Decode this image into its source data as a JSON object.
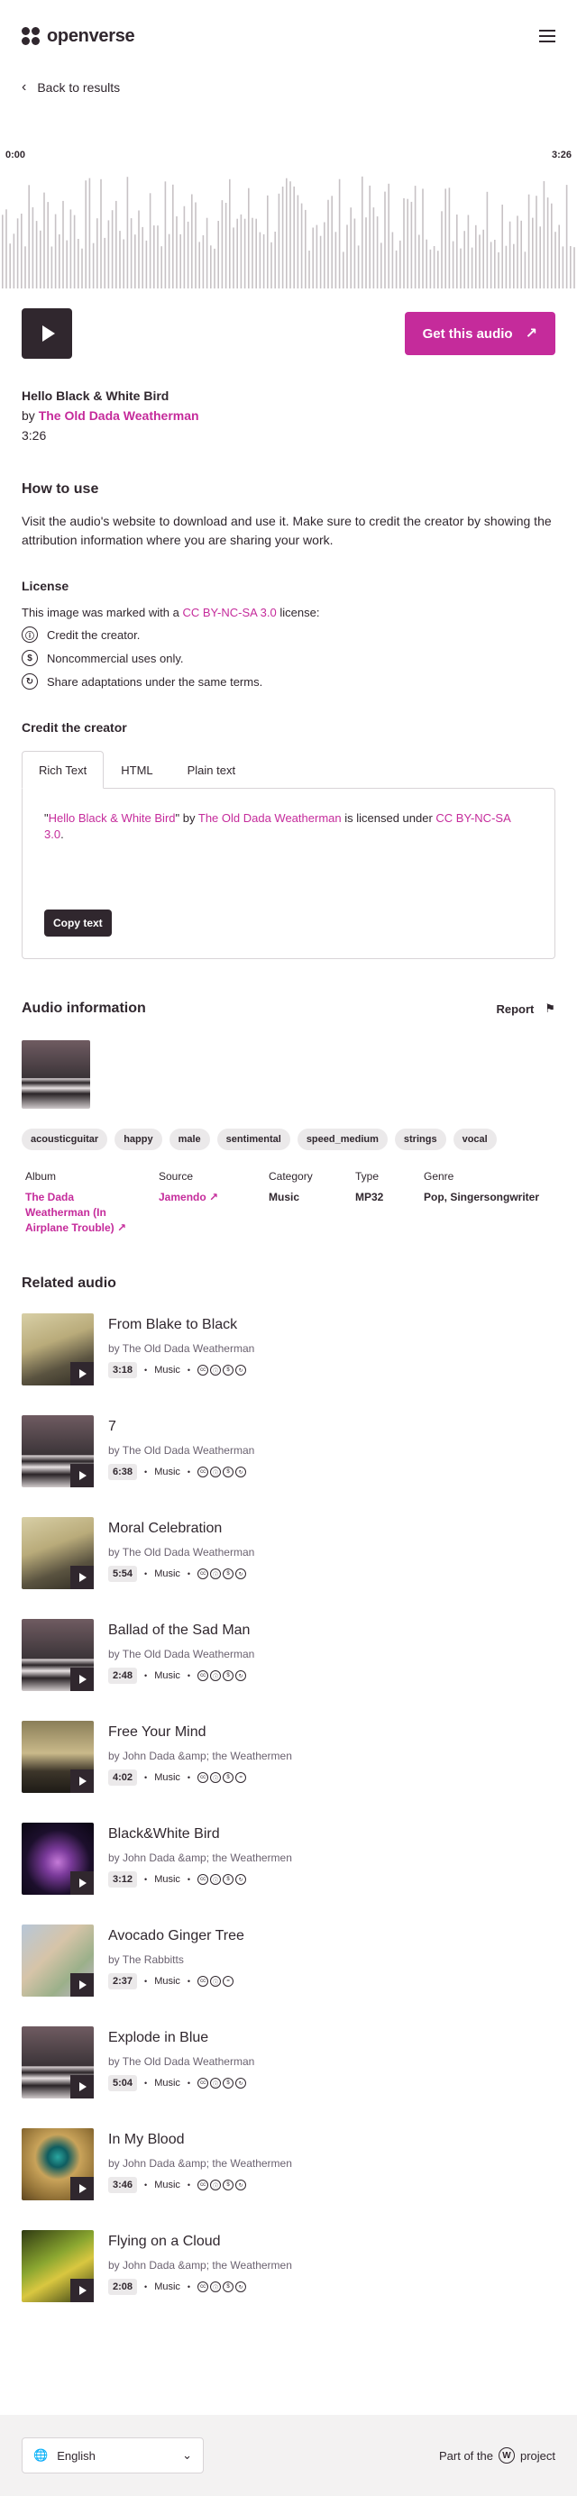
{
  "header": {
    "brand": "openverse"
  },
  "nav": {
    "back_label": "Back to results"
  },
  "player": {
    "time_start": "0:00",
    "time_end": "3:26",
    "get_label": "Get this audio"
  },
  "track": {
    "title": "Hello Black & White Bird",
    "by_prefix": "by",
    "artist": "The Old Dada Weatherman",
    "duration": "3:26"
  },
  "how_to": {
    "heading": "How to use",
    "text": "Visit the audio's website to download and use it. Make sure to credit the creator by showing the attribution information where you are sharing your work."
  },
  "license": {
    "heading": "License",
    "intro_prefix": "This image was marked with a",
    "license_name": "CC BY-NC-SA 3.0",
    "intro_suffix": "license:",
    "items": [
      {
        "icon": "by-icon",
        "text": "Credit the creator."
      },
      {
        "icon": "nc-icon",
        "text": "Noncommercial uses only."
      },
      {
        "icon": "sa-icon",
        "text": "Share adaptations under the same terms."
      }
    ]
  },
  "credit": {
    "heading": "Credit the creator",
    "tabs": [
      "Rich Text",
      "HTML",
      "Plain text"
    ],
    "q_open": "\"",
    "title_link": "Hello Black & White Bird",
    "q_close": "\" by",
    "creator_link": "The Old Dada Weatherman",
    "licensed_under": "is licensed under",
    "license_link": "CC BY-NC-SA 3.0",
    "period": ".",
    "copy_label": "Copy text"
  },
  "audio_info": {
    "heading": "Audio information",
    "report_label": "Report",
    "tags": [
      "acousticguitar",
      "happy",
      "male",
      "sentimental",
      "speed_medium",
      "strings",
      "vocal"
    ],
    "fields": {
      "album_label": "Album",
      "album_value": "The Dada Weatherman (In Airplane Trouble)",
      "source_label": "Source",
      "source_value": "Jamendo",
      "category_label": "Category",
      "category_value": "Music",
      "type_label": "Type",
      "type_value": "MP32",
      "genre_label": "Genre",
      "genre_value": "Pop, Singersongwriter"
    }
  },
  "related": {
    "heading": "Related audio",
    "category": "Music",
    "items": [
      {
        "title": "From Blake to Black",
        "by": "by The Old Dada Weatherman",
        "duration": "3:18",
        "licenses": [
          "cc",
          "by",
          "nc",
          "sa"
        ],
        "art": "sheet"
      },
      {
        "title": "7",
        "by": "by The Old Dada Weatherman",
        "duration": "6:38",
        "licenses": [
          "cc",
          "by",
          "nc",
          "sa"
        ],
        "art": "bird"
      },
      {
        "title": "Moral Celebration",
        "by": "by The Old Dada Weatherman",
        "duration": "5:54",
        "licenses": [
          "cc",
          "by",
          "nc",
          "sa"
        ],
        "art": "sheet"
      },
      {
        "title": "Ballad of the Sad Man",
        "by": "by The Old Dada Weatherman",
        "duration": "2:48",
        "licenses": [
          "cc",
          "by",
          "nc",
          "sa"
        ],
        "art": "bird"
      },
      {
        "title": "Free Your Mind",
        "by": "by John Dada &amp; the Weathermen",
        "duration": "4:02",
        "licenses": [
          "cc",
          "by",
          "nc",
          "nd"
        ],
        "art": "land"
      },
      {
        "title": "Black&White Bird",
        "by": "by John Dada &amp; the Weathermen",
        "duration": "3:12",
        "licenses": [
          "cc",
          "by",
          "nc",
          "sa"
        ],
        "art": "lotus"
      },
      {
        "title": "Avocado Ginger Tree",
        "by": "by The Rabbitts",
        "duration": "2:37",
        "licenses": [
          "cc",
          "by",
          "nd"
        ],
        "art": "sketch"
      },
      {
        "title": "Explode in Blue",
        "by": "by The Old Dada Weatherman",
        "duration": "5:04",
        "licenses": [
          "cc",
          "by",
          "nc",
          "sa"
        ],
        "art": "bird"
      },
      {
        "title": "In My Blood",
        "by": "by John Dada &amp; the Weathermen",
        "duration": "3:46",
        "licenses": [
          "cc",
          "by",
          "nc",
          "sa"
        ],
        "art": "gold"
      },
      {
        "title": "Flying on a Cloud",
        "by": "by John Dada &amp; the Weathermen",
        "duration": "2:08",
        "licenses": [
          "cc",
          "by",
          "nc",
          "sa"
        ],
        "art": "green"
      }
    ]
  },
  "footer": {
    "language": "English",
    "part_of_prefix": "Part of the",
    "part_of_suffix": "project"
  },
  "colors": {
    "accent": "#c52b9b",
    "dark": "#30272e",
    "tag_bg": "#ebe9ea",
    "footer_bg": "#f3f2f2"
  }
}
